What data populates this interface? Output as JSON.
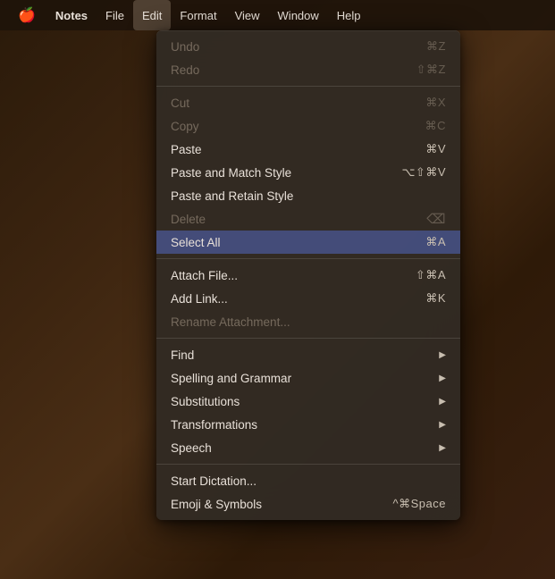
{
  "menubar": {
    "apple_icon": "🍎",
    "items": [
      {
        "label": "Notes",
        "bold": true,
        "active": false
      },
      {
        "label": "File",
        "active": false
      },
      {
        "label": "Edit",
        "active": true
      },
      {
        "label": "Format",
        "active": false
      },
      {
        "label": "View",
        "active": false
      },
      {
        "label": "Window",
        "active": false
      },
      {
        "label": "Help",
        "active": false
      }
    ]
  },
  "dropdown": {
    "sections": [
      {
        "items": [
          {
            "label": "Undo",
            "shortcut": "⌘Z",
            "disabled": true,
            "arrow": false
          },
          {
            "label": "Redo",
            "shortcut": "⇧⌘Z",
            "disabled": true,
            "arrow": false
          }
        ]
      },
      {
        "items": [
          {
            "label": "Cut",
            "shortcut": "⌘X",
            "disabled": true,
            "arrow": false
          },
          {
            "label": "Copy",
            "shortcut": "⌘C",
            "disabled": true,
            "arrow": false
          },
          {
            "label": "Paste",
            "shortcut": "⌘V",
            "disabled": false,
            "arrow": false
          },
          {
            "label": "Paste and Match Style",
            "shortcut": "⌥⇧⌘V",
            "disabled": false,
            "arrow": false
          },
          {
            "label": "Paste and Retain Style",
            "shortcut": "",
            "disabled": false,
            "arrow": false
          },
          {
            "label": "Delete",
            "shortcut": "⌫",
            "disabled": true,
            "arrow": false
          },
          {
            "label": "Select All",
            "shortcut": "⌘A",
            "disabled": false,
            "highlighted": true,
            "arrow": false
          }
        ]
      },
      {
        "items": [
          {
            "label": "Attach File...",
            "shortcut": "⇧⌘A",
            "disabled": false,
            "arrow": false
          },
          {
            "label": "Add Link...",
            "shortcut": "⌘K",
            "disabled": false,
            "arrow": false
          },
          {
            "label": "Rename Attachment...",
            "shortcut": "",
            "disabled": true,
            "arrow": false
          }
        ]
      },
      {
        "items": [
          {
            "label": "Find",
            "shortcut": "",
            "disabled": false,
            "arrow": true
          },
          {
            "label": "Spelling and Grammar",
            "shortcut": "",
            "disabled": false,
            "arrow": true
          },
          {
            "label": "Substitutions",
            "shortcut": "",
            "disabled": false,
            "arrow": true
          },
          {
            "label": "Transformations",
            "shortcut": "",
            "disabled": false,
            "arrow": true
          },
          {
            "label": "Speech",
            "shortcut": "",
            "disabled": false,
            "arrow": true
          }
        ]
      },
      {
        "items": [
          {
            "label": "Start Dictation...",
            "shortcut": "",
            "disabled": false,
            "arrow": false
          },
          {
            "label": "Emoji & Symbols",
            "shortcut": "^⌘Space",
            "disabled": false,
            "arrow": false
          }
        ]
      }
    ]
  }
}
